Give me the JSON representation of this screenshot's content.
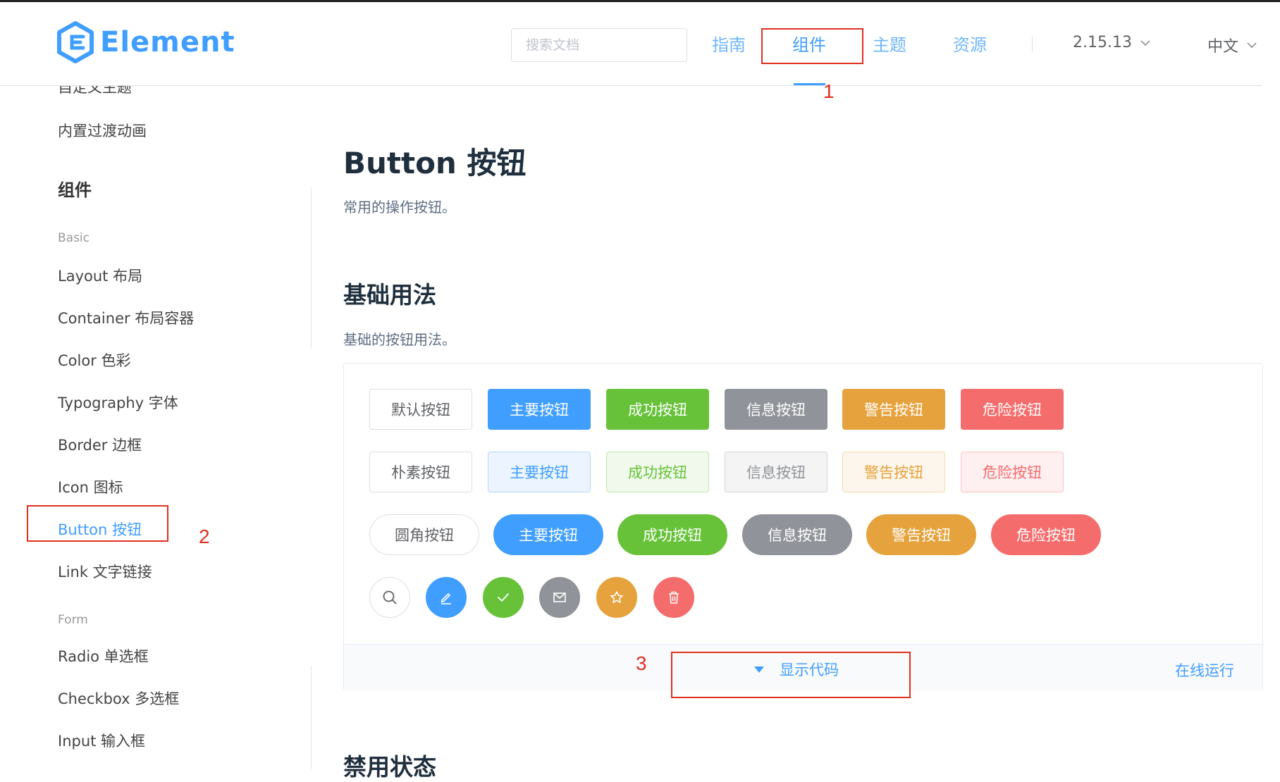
{
  "header": {
    "logo_text": "Element",
    "search_placeholder": "搜索文档",
    "nav": [
      "指南",
      "组件",
      "主题",
      "资源"
    ],
    "version": "2.15.13",
    "language": "中文"
  },
  "annotations": [
    "1",
    "2",
    "3"
  ],
  "sidebar": {
    "items_top": [
      "自定义主题",
      "内置过渡动画"
    ],
    "heading": "组件",
    "group_basic": "Basic",
    "basic_items": [
      "Layout 布局",
      "Container 布局容器",
      "Color 色彩",
      "Typography 字体",
      "Border 边框",
      "Icon 图标",
      "Button 按钮",
      "Link 文字链接"
    ],
    "group_form": "Form",
    "form_items": [
      "Radio 单选框",
      "Checkbox 多选框",
      "Input 输入框"
    ]
  },
  "content": {
    "title": "Button 按钮",
    "subtitle": "常用的操作按钮。",
    "section1_title": "基础用法",
    "section1_desc": "基础的按钮用法。",
    "section2_title": "禁用状态"
  },
  "demo": {
    "row1": [
      "默认按钮",
      "主要按钮",
      "成功按钮",
      "信息按钮",
      "警告按钮",
      "危险按钮"
    ],
    "row2": [
      "朴素按钮",
      "主要按钮",
      "成功按钮",
      "信息按钮",
      "警告按钮",
      "危险按钮"
    ],
    "row3": [
      "圆角按钮",
      "主要按钮",
      "成功按钮",
      "信息按钮",
      "警告按钮",
      "危险按钮"
    ],
    "icons": [
      "search-icon",
      "edit-icon",
      "check-icon",
      "message-icon",
      "star-icon",
      "delete-icon"
    ],
    "show_code": "显示代码",
    "run_online": "在线运行"
  },
  "colors": {
    "primary": "#409eff",
    "success": "#67c23a",
    "info": "#909399",
    "warning": "#e6a23c",
    "danger": "#f56c6c",
    "annotation": "#e0301e"
  }
}
